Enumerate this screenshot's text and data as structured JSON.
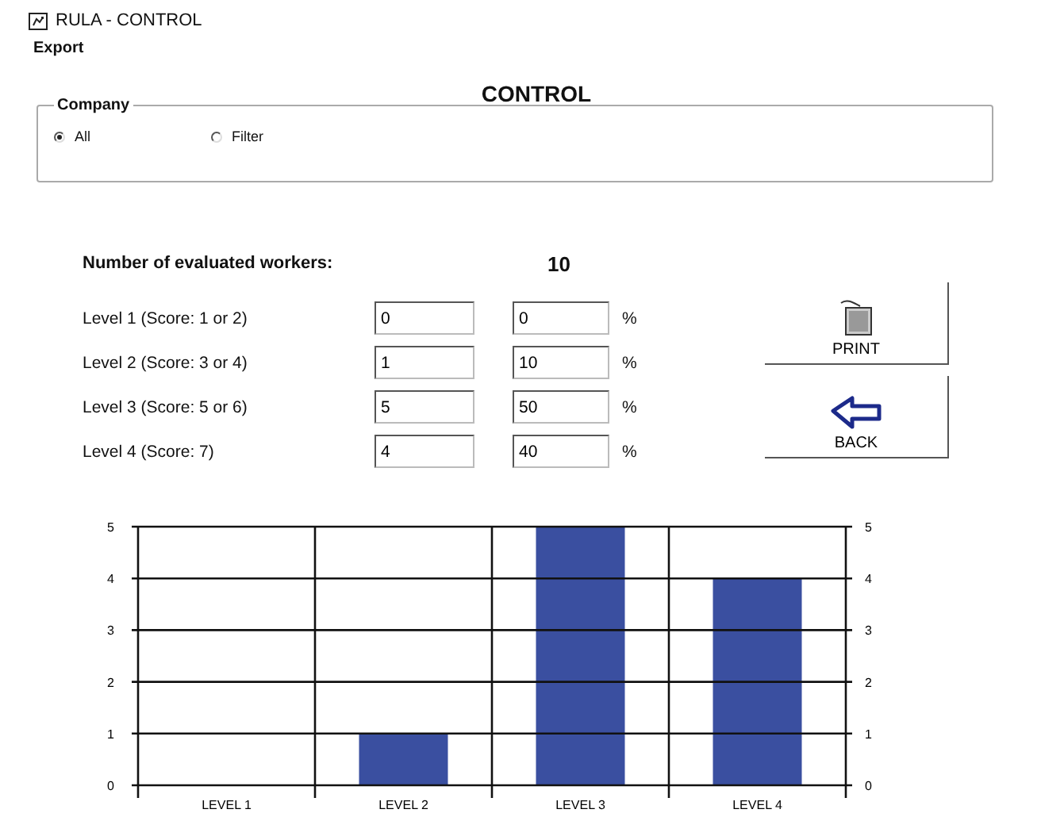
{
  "window": {
    "title": "RULA - CONTROL"
  },
  "menu": [
    "Export"
  ],
  "heading": "CONTROL",
  "company": {
    "legend": "Company",
    "options": [
      {
        "label": "All",
        "selected": true
      },
      {
        "label": "Filter",
        "selected": false
      }
    ]
  },
  "summary": {
    "label": "Number of evaluated workers:",
    "value": "10"
  },
  "levels": [
    {
      "label": "Level 1 (Score: 1 or 2)",
      "count": "0",
      "percent": "0",
      "unit": "%"
    },
    {
      "label": "Level 2 (Score: 3 or 4)",
      "count": "1",
      "percent": "10",
      "unit": "%"
    },
    {
      "label": "Level 3 (Score: 5 or 6)",
      "count": "5",
      "percent": "50",
      "unit": "%"
    },
    {
      "label": "Level 4 (Score: 7)",
      "count": "4",
      "percent": "40",
      "unit": "%"
    }
  ],
  "buttons": [
    {
      "kind": "print",
      "label": "PRINT"
    },
    {
      "kind": "back",
      "label": "BACK"
    }
  ],
  "chart": {
    "chart_data": {
      "type": "bar",
      "categories": [
        "LEVEL 1",
        "LEVEL 2",
        "LEVEL 3",
        "LEVEL 4"
      ],
      "series": [
        {
          "color": "#3a4fa0",
          "values": [
            0,
            1,
            5,
            4
          ]
        }
      ],
      "ylim": [
        0,
        5
      ],
      "yticks": [
        0,
        1,
        2,
        3,
        4,
        5
      ],
      "y2ticks": [
        0,
        1,
        2,
        3,
        4,
        5
      ],
      "y2lim": [
        0,
        5
      ],
      "grid": true
    }
  }
}
